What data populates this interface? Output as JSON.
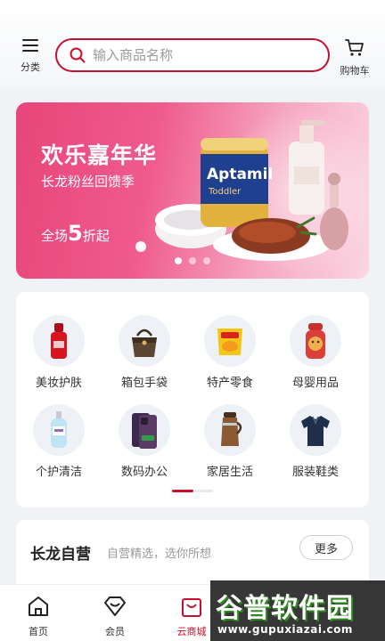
{
  "header": {
    "category_label": "分类",
    "cart_label": "购物车",
    "search": {
      "placeholder": "输入商品名称",
      "value": ""
    }
  },
  "banner": {
    "title": "欢乐嘉年华",
    "subtitle": "长龙粉丝回馈季",
    "promo_prefix": "全场",
    "promo_number": "5",
    "promo_suffix": "折起",
    "product_label": "Aptamil",
    "product_sub": "Toddler",
    "slides": 3,
    "active_slide": 1
  },
  "categories": [
    {
      "label": "美妆护肤",
      "icon": "cosmetics-icon"
    },
    {
      "label": "箱包手袋",
      "icon": "handbag-icon"
    },
    {
      "label": "特产零食",
      "icon": "snack-icon"
    },
    {
      "label": "母婴用品",
      "icon": "baby-bottle-icon"
    },
    {
      "label": "个护清洁",
      "icon": "shower-gel-icon"
    },
    {
      "label": "数码办公",
      "icon": "phone-icon"
    },
    {
      "label": "家居生活",
      "icon": "thermos-icon"
    },
    {
      "label": "服装鞋类",
      "icon": "shirt-icon"
    }
  ],
  "self_run": {
    "title": "长龙自营",
    "subtitle": "自营精选，选你所想",
    "more_label": "更多"
  },
  "bottom_nav": [
    {
      "label": "首页",
      "icon": "home-icon",
      "active": false
    },
    {
      "label": "会员",
      "icon": "member-icon",
      "active": false
    },
    {
      "label": "云商城",
      "icon": "shop-bag-icon",
      "active": true
    }
  ],
  "watermark": {
    "text": "谷普软件园",
    "url": "www.gupuxiazai.com"
  },
  "colors": {
    "accent": "#c8102e",
    "banner": "#e8457a"
  }
}
